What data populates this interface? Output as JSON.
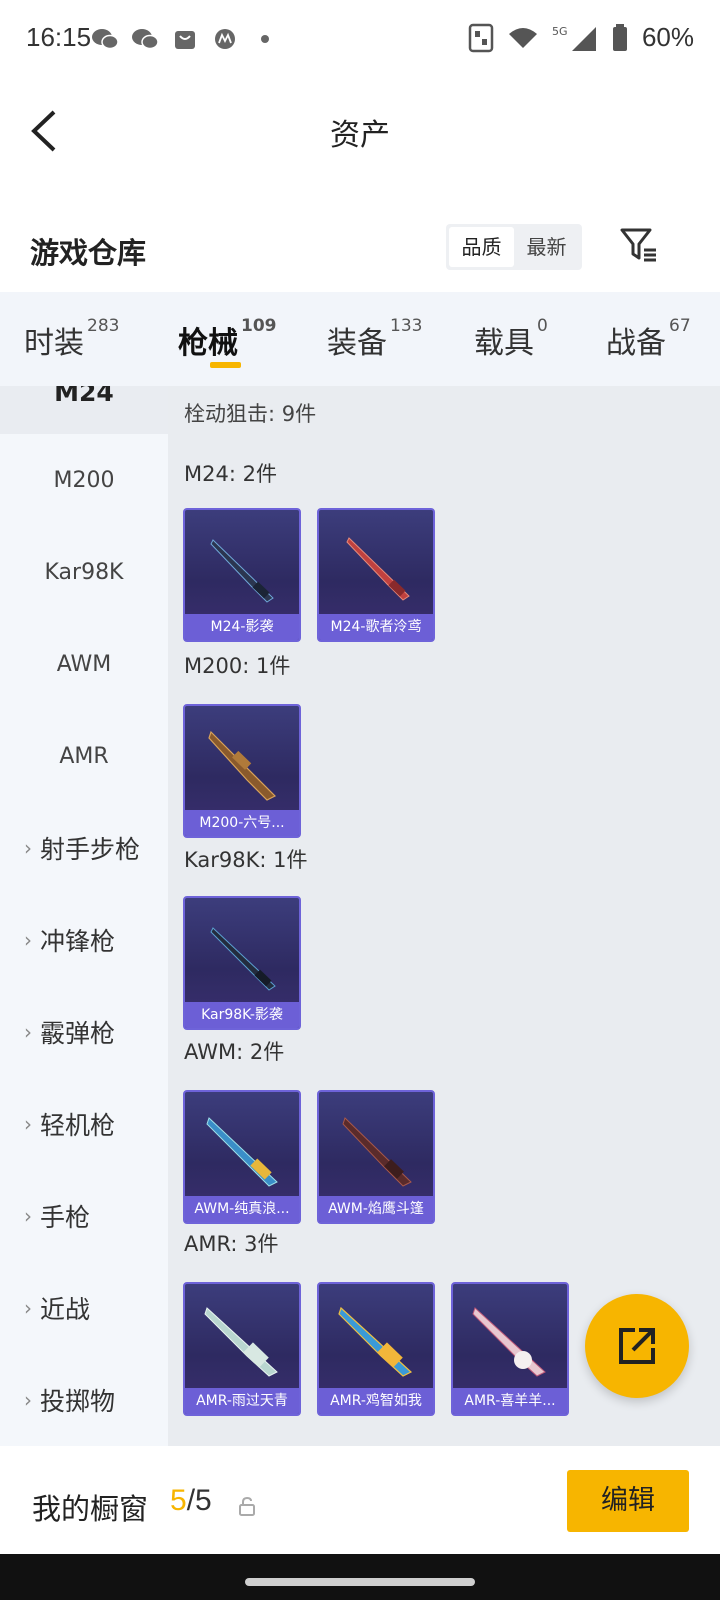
{
  "status_bar": {
    "time": "16:15",
    "battery": "60%",
    "network": "5G"
  },
  "header": {
    "title": "资产"
  },
  "warehouse": {
    "title": "游戏仓库",
    "sort_options": [
      "品质",
      "最新"
    ],
    "active_sort": "品质"
  },
  "tabs": [
    {
      "label": "时装",
      "count": "283"
    },
    {
      "label": "枪械",
      "count": "109",
      "active": true
    },
    {
      "label": "装备",
      "count": "133"
    },
    {
      "label": "载具",
      "count": "0"
    },
    {
      "label": "战备",
      "count": "67"
    }
  ],
  "sidebar": {
    "selected": "M24",
    "sub_items": [
      "M200",
      "Kar98K",
      "AWM",
      "AMR"
    ],
    "categories": [
      "射手步枪",
      "冲锋枪",
      "霰弹枪",
      "轻机枪",
      "手枪",
      "近战",
      "投掷物"
    ]
  },
  "content": {
    "section_title": "栓动狙击: 9件",
    "groups": [
      {
        "label": "M24: 2件",
        "items": [
          "M24-影袭",
          "M24-歌者泠鸢"
        ]
      },
      {
        "label": "M200: 1件",
        "items": [
          "M200-六号..."
        ]
      },
      {
        "label": "Kar98K: 1件",
        "items": [
          "Kar98K-影袭"
        ]
      },
      {
        "label": "AWM: 2件",
        "items": [
          "AWM-纯真浪...",
          "AWM-焰鹰斗篷"
        ]
      },
      {
        "label": "AMR: 3件",
        "items": [
          "AMR-雨过天青",
          "AMR-鸡智如我",
          "AMR-喜羊羊..."
        ]
      }
    ]
  },
  "bottom_bar": {
    "label": "我的橱窗",
    "count_current": "5",
    "count_total": "/5",
    "edit_label": "编辑"
  },
  "colors": {
    "accent": "#f7b500",
    "card_bg": "#2e2a61",
    "card_label": "#6c5fd6"
  }
}
